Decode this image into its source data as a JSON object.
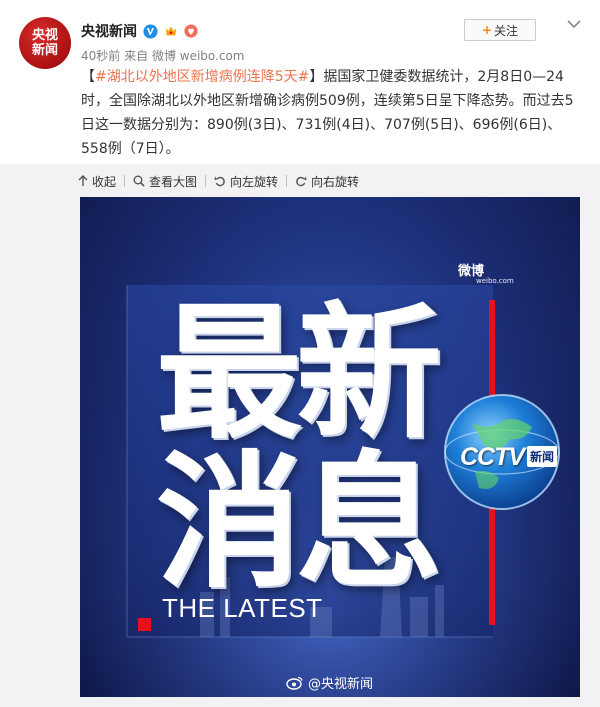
{
  "post": {
    "author": "央视新闻",
    "avatar_text": "央视\n新闻",
    "time": "40秒前",
    "source_prefix": "来自",
    "source": "微博 weibo.com",
    "follow_label": "关注",
    "hashtag": "#湖北以外地区新增病例连降5天#",
    "bracket_open": "【",
    "bracket_close": "】",
    "body": "据国家卫健委数据统计，2月8日0—24时，全国除湖北以外地区新增确诊病例509例，连续第5日呈下降态势。而过去5日这一数据分别为：890例(3日)、731例(4日)、707例(5日)、696例(6日)、558例（7日）。"
  },
  "toolbar": {
    "collapse": "收起",
    "view_large": "查看大图",
    "rotate_left": "向左旋转",
    "rotate_right": "向右旋转"
  },
  "image": {
    "headline_1": "最新",
    "headline_2": "消息",
    "subtitle": "THE LATEST",
    "weibo_mark": "微博",
    "weibo_mark_small": "weibo.com",
    "cctv_logo": "CCTV",
    "cctv_cn": "新闻",
    "watermark": "@央视新闻"
  },
  "colors": {
    "tag": "#eb7350",
    "accent_orange": "#ff8200",
    "red_bar": "#e8101d",
    "bg_blue": "#1d307a"
  },
  "icons": [
    "verified-badge-icon",
    "vip-crown-icon",
    "fan-badge-icon",
    "plus-icon",
    "chevron-down-icon",
    "collapse-arrow-icon",
    "magnifier-icon",
    "rotate-left-icon",
    "rotate-right-icon",
    "weibo-eye-icon",
    "globe-icon"
  ]
}
